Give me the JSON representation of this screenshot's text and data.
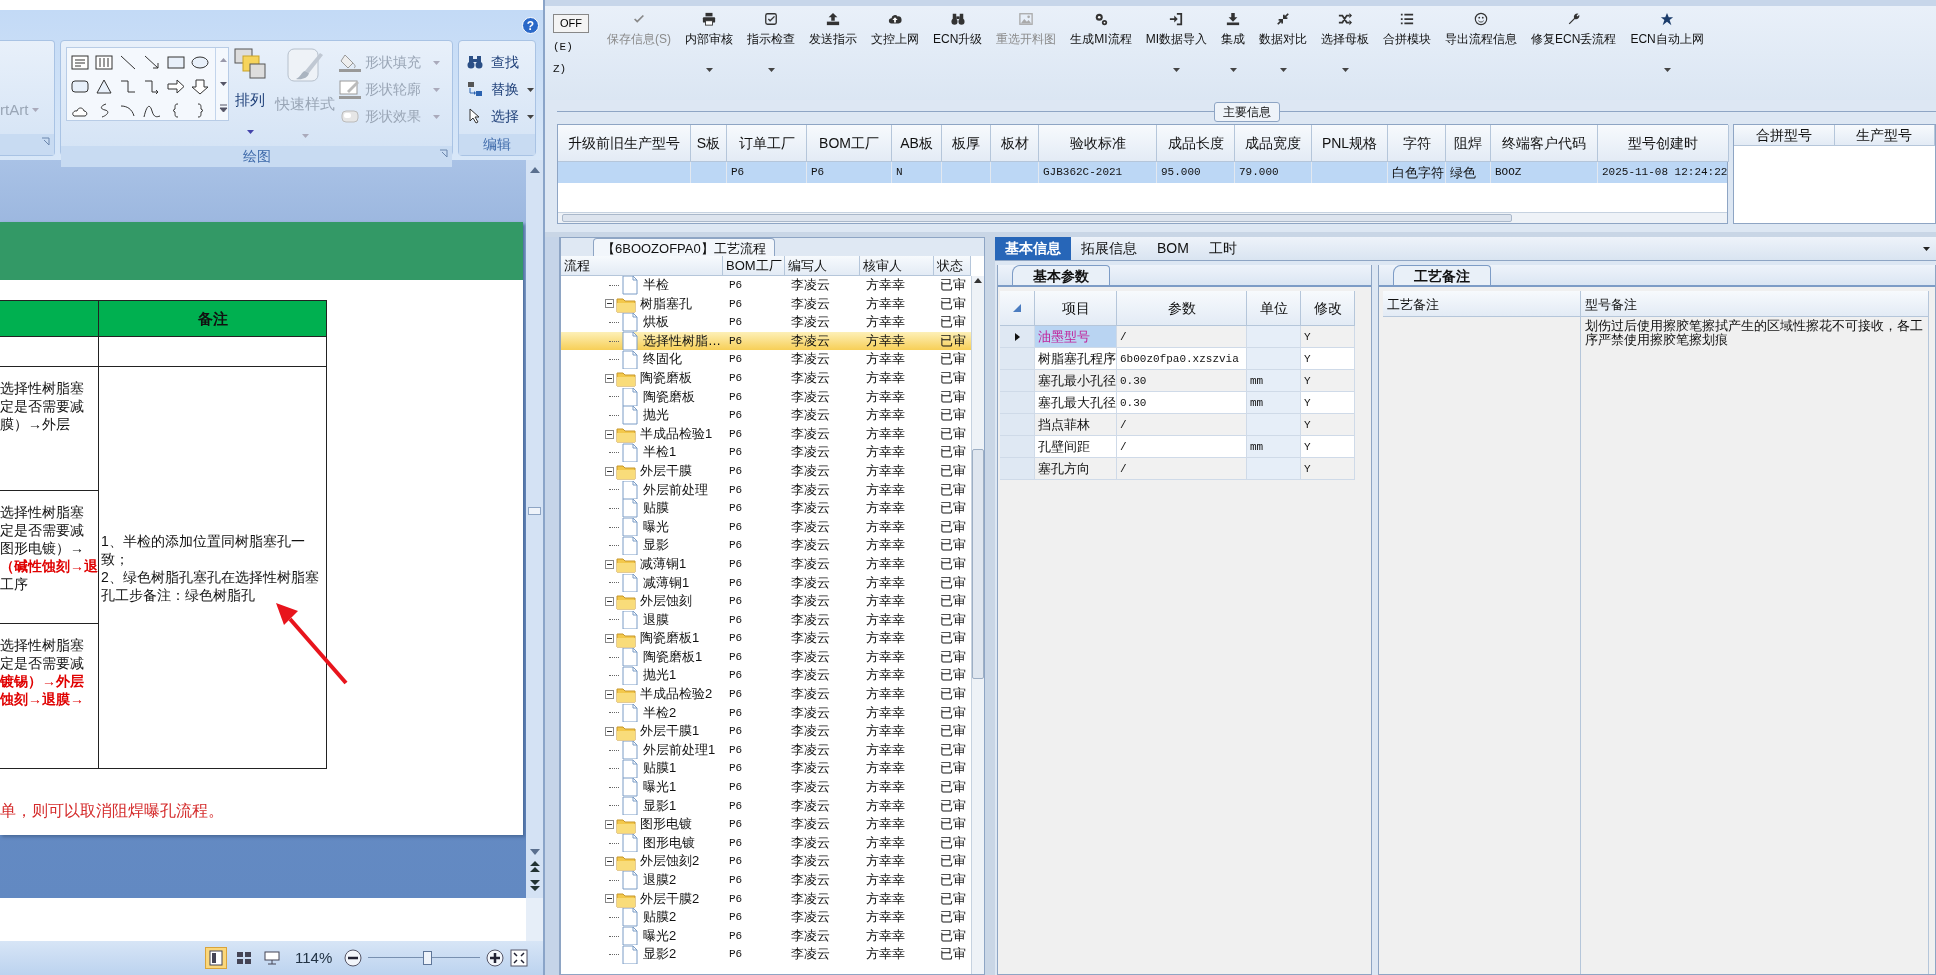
{
  "word": {
    "help_button": "?",
    "ribbon": {
      "smartart": {
        "label": "rtArt",
        "disabled": true
      },
      "drawing": {
        "title": "绘图",
        "arrange": {
          "label": "排列",
          "disabled": false
        },
        "quick_styles": {
          "label": "快速样式",
          "disabled": true
        },
        "shape_fill": {
          "label": "形状填充",
          "disabled": true
        },
        "shape_outline": {
          "label": "形状轮廓",
          "disabled": true
        },
        "shape_effects": {
          "label": "形状效果",
          "disabled": true
        }
      },
      "editing": {
        "title": "编辑",
        "find": "查找",
        "replace": "替换",
        "select": "选择"
      }
    },
    "document": {
      "table": {
        "remarks_header": "备注",
        "rows": [
          {
            "kind": "blank"
          },
          {
            "kind": "text",
            "lines": [
              {
                "text": "选择性树脂塞",
                "emphasis": false
              },
              {
                "text": "定是否需要减",
                "emphasis": false
              },
              {
                "text": "膜）→外层",
                "emphasis": false
              }
            ]
          },
          {
            "kind": "text",
            "lines": [
              {
                "text": "选择性树脂塞",
                "emphasis": false
              },
              {
                "text": "定是否需要减",
                "emphasis": false
              },
              {
                "text": "图形电镀）→",
                "emphasis": false
              },
              {
                "text": "（碱性蚀刻→退",
                "emphasis": true
              },
              {
                "text": "工序",
                "emphasis": false
              }
            ]
          },
          {
            "kind": "text",
            "lines": [
              {
                "text": "选择性树脂塞",
                "emphasis": false
              },
              {
                "text": "定是否需要减",
                "emphasis": false
              },
              {
                "text": "镀锡）→外层",
                "emphasis": true
              },
              {
                "text": "蚀刻→退膜→",
                "emphasis": true
              }
            ]
          }
        ],
        "remarks": [
          "1、半检的添加位置同树脂塞孔一致；",
          "2、绿色树脂孔塞孔在选择性树脂塞孔工步备注：绿色树脂孔"
        ]
      },
      "footer_note": "单，则可以取消阻焊曝孔流程。"
    },
    "status_bar": {
      "view_buttons": [
        {
          "selected": true
        },
        {
          "selected": false
        },
        {
          "selected": false
        }
      ],
      "zoom": "114%",
      "zoom_slider": {
        "level": 0.52
      }
    }
  },
  "app": {
    "toolbar": {
      "off_button": "OFF",
      "menu_fragments": [
        "(E)",
        "Z)"
      ],
      "buttons": [
        {
          "label": "保存信息(S)",
          "disabled": true,
          "dropdown": false
        },
        {
          "label": "内部审核",
          "disabled": false,
          "dropdown": true
        },
        {
          "label": "指示检查",
          "disabled": false,
          "dropdown": true
        },
        {
          "label": "发送指示",
          "disabled": false,
          "dropdown": false
        },
        {
          "label": "文控上网",
          "disabled": false,
          "dropdown": false
        },
        {
          "label": "ECN升级",
          "disabled": false,
          "dropdown": false
        },
        {
          "label": "重选开料图",
          "disabled": true,
          "dropdown": false
        },
        {
          "label": "生成MI流程",
          "disabled": false,
          "dropdown": false
        },
        {
          "label": "MI数据导入",
          "disabled": false,
          "dropdown": true
        },
        {
          "label": "集成",
          "disabled": false,
          "dropdown": true
        },
        {
          "label": "数据对比",
          "disabled": false,
          "dropdown": true
        },
        {
          "label": "选择母板",
          "disabled": false,
          "dropdown": true
        },
        {
          "label": "合拼模块",
          "disabled": false,
          "dropdown": false
        },
        {
          "label": "导出流程信息",
          "disabled": false,
          "dropdown": false
        },
        {
          "label": "修复ECN丢流程",
          "disabled": false,
          "dropdown": false
        },
        {
          "label": "ECN自动上网",
          "disabled": false,
          "dropdown": true
        }
      ]
    },
    "main_info": {
      "title": "主要信息",
      "columns": [
        "升级前旧生产型号",
        "S板",
        "订单工厂",
        "BOM工厂",
        "AB板",
        "板厚",
        "板材",
        "验收标准",
        "成品长度",
        "成品宽度",
        "PNL规格",
        "字符",
        "阻焊",
        "终端客户代码",
        "型号创建时"
      ],
      "rows": [
        {
          "selected": true,
          "cells": [
            null,
            null,
            "P6",
            "P6",
            "N",
            null,
            null,
            "GJB362C-2021",
            "95.000",
            "79.000",
            null,
            "白色字符",
            "绿色",
            "BOOZ",
            "2025-11-08 12:24:22"
          ]
        }
      ],
      "side_columns": [
        "合拼型号",
        "生产型号"
      ]
    },
    "flow_panel": {
      "tab": "【6BOOZOFPA0】工艺流程",
      "columns": [
        "流程",
        "BOM工厂",
        "编写人",
        "核审人",
        "状态"
      ],
      "tree": [
        {
          "kind": "step",
          "label": "半检",
          "bom": "P6",
          "author": "李凌云",
          "reviewer": "方幸幸",
          "status": "已审",
          "selected": false
        },
        {
          "kind": "folder",
          "label": "树脂塞孔",
          "bom": "P6",
          "author": "李凌云",
          "reviewer": "方幸幸",
          "status": "已审",
          "selected": false,
          "expanded": true,
          "children": [
            {
              "kind": "step",
              "label": "烘板",
              "bom": "P6",
              "author": "李凌云",
              "reviewer": "方幸幸",
              "status": "已审",
              "selected": false
            },
            {
              "kind": "step",
              "label": "选择性树脂…",
              "bom": "P6",
              "author": "李凌云",
              "reviewer": "方幸幸",
              "status": "已审",
              "selected": true
            },
            {
              "kind": "step",
              "label": "终固化",
              "bom": "P6",
              "author": "李凌云",
              "reviewer": "方幸幸",
              "status": "已审",
              "selected": false
            }
          ]
        },
        {
          "kind": "folder",
          "label": "陶瓷磨板",
          "bom": "P6",
          "author": "李凌云",
          "reviewer": "方幸幸",
          "status": "已审",
          "selected": false,
          "expanded": true,
          "children": [
            {
              "kind": "step",
              "label": "陶瓷磨板",
              "bom": "P6",
              "author": "李凌云",
              "reviewer": "方幸幸",
              "status": "已审",
              "selected": false
            },
            {
              "kind": "step",
              "label": "抛光",
              "bom": "P6",
              "author": "李凌云",
              "reviewer": "方幸幸",
              "status": "已审",
              "selected": false
            }
          ]
        },
        {
          "kind": "folder",
          "label": "半成品检验1",
          "bom": "P6",
          "author": "李凌云",
          "reviewer": "方幸幸",
          "status": "已审",
          "selected": false,
          "expanded": true,
          "children": [
            {
              "kind": "step",
              "label": "半检1",
              "bom": "P6",
              "author": "李凌云",
              "reviewer": "方幸幸",
              "status": "已审",
              "selected": false
            }
          ]
        },
        {
          "kind": "folder",
          "label": "外层干膜",
          "bom": "P6",
          "author": "李凌云",
          "reviewer": "方幸幸",
          "status": "已审",
          "selected": false,
          "expanded": true,
          "children": [
            {
              "kind": "step",
              "label": "外层前处理",
              "bom": "P6",
              "author": "李凌云",
              "reviewer": "方幸幸",
              "status": "已审",
              "selected": false
            },
            {
              "kind": "step",
              "label": "贴膜",
              "bom": "P6",
              "author": "李凌云",
              "reviewer": "方幸幸",
              "status": "已审",
              "selected": false
            },
            {
              "kind": "step",
              "label": "曝光",
              "bom": "P6",
              "author": "李凌云",
              "reviewer": "方幸幸",
              "status": "已审",
              "selected": false
            },
            {
              "kind": "step",
              "label": "显影",
              "bom": "P6",
              "author": "李凌云",
              "reviewer": "方幸幸",
              "status": "已审",
              "selected": false
            }
          ]
        },
        {
          "kind": "folder",
          "label": "减薄铜1",
          "bom": "P6",
          "author": "李凌云",
          "reviewer": "方幸幸",
          "status": "已审",
          "selected": false,
          "expanded": true,
          "children": [
            {
              "kind": "step",
              "label": "减薄铜1",
              "bom": "P6",
              "author": "李凌云",
              "reviewer": "方幸幸",
              "status": "已审",
              "selected": false
            }
          ]
        },
        {
          "kind": "folder",
          "label": "外层蚀刻",
          "bom": "P6",
          "author": "李凌云",
          "reviewer": "方幸幸",
          "status": "已审",
          "selected": false,
          "expanded": true,
          "children": [
            {
              "kind": "step",
              "label": "退膜",
              "bom": "P6",
              "author": "李凌云",
              "reviewer": "方幸幸",
              "status": "已审",
              "selected": false
            }
          ]
        },
        {
          "kind": "folder",
          "label": "陶瓷磨板1",
          "bom": "P6",
          "author": "李凌云",
          "reviewer": "方幸幸",
          "status": "已审",
          "selected": false,
          "expanded": true,
          "children": [
            {
              "kind": "step",
              "label": "陶瓷磨板1",
              "bom": "P6",
              "author": "李凌云",
              "reviewer": "方幸幸",
              "status": "已审",
              "selected": false
            },
            {
              "kind": "step",
              "label": "抛光1",
              "bom": "P6",
              "author": "李凌云",
              "reviewer": "方幸幸",
              "status": "已审",
              "selected": false
            }
          ]
        },
        {
          "kind": "folder",
          "label": "半成品检验2",
          "bom": "P6",
          "author": "李凌云",
          "reviewer": "方幸幸",
          "status": "已审",
          "selected": false,
          "expanded": true,
          "children": [
            {
              "kind": "step",
              "label": "半检2",
              "bom": "P6",
              "author": "李凌云",
              "reviewer": "方幸幸",
              "status": "已审",
              "selected": false
            }
          ]
        },
        {
          "kind": "folder",
          "label": "外层干膜1",
          "bom": "P6",
          "author": "李凌云",
          "reviewer": "方幸幸",
          "status": "已审",
          "selected": false,
          "expanded": true,
          "children": [
            {
              "kind": "step",
              "label": "外层前处理1",
              "bom": "P6",
              "author": "李凌云",
              "reviewer": "方幸幸",
              "status": "已审",
              "selected": false
            },
            {
              "kind": "step",
              "label": "贴膜1",
              "bom": "P6",
              "author": "李凌云",
              "reviewer": "方幸幸",
              "status": "已审",
              "selected": false
            },
            {
              "kind": "step",
              "label": "曝光1",
              "bom": "P6",
              "author": "李凌云",
              "reviewer": "方幸幸",
              "status": "已审",
              "selected": false
            },
            {
              "kind": "step",
              "label": "显影1",
              "bom": "P6",
              "author": "李凌云",
              "reviewer": "方幸幸",
              "status": "已审",
              "selected": false
            }
          ]
        },
        {
          "kind": "folder",
          "label": "图形电镀",
          "bom": "P6",
          "author": "李凌云",
          "reviewer": "方幸幸",
          "status": "已审",
          "selected": false,
          "expanded": true,
          "children": [
            {
              "kind": "step",
              "label": "图形电镀",
              "bom": "P6",
              "author": "李凌云",
              "reviewer": "方幸幸",
              "status": "已审",
              "selected": false
            }
          ]
        },
        {
          "kind": "folder",
          "label": "外层蚀刻2",
          "bom": "P6",
          "author": "李凌云",
          "reviewer": "方幸幸",
          "status": "已审",
          "selected": false,
          "expanded": true,
          "children": [
            {
              "kind": "step",
              "label": "退膜2",
              "bom": "P6",
              "author": "李凌云",
              "reviewer": "方幸幸",
              "status": "已审",
              "selected": false
            }
          ]
        },
        {
          "kind": "folder",
          "label": "外层干膜2",
          "bom": "P6",
          "author": "李凌云",
          "reviewer": "方幸幸",
          "status": "已审",
          "selected": false,
          "expanded": true,
          "children": [
            {
              "kind": "step",
              "label": "贴膜2",
              "bom": "P6",
              "author": "李凌云",
              "reviewer": "方幸幸",
              "status": "已审",
              "selected": false
            },
            {
              "kind": "step",
              "label": "曝光2",
              "bom": "P6",
              "author": "李凌云",
              "reviewer": "方幸幸",
              "status": "已审",
              "selected": false
            },
            {
              "kind": "step",
              "label": "显影2",
              "bom": "P6",
              "author": "李凌云",
              "reviewer": "方幸幸",
              "status": "已审",
              "selected": false
            }
          ]
        }
      ]
    },
    "detail_panel": {
      "tabs": [
        {
          "label": "基本信息",
          "selected": true
        },
        {
          "label": "拓展信息",
          "selected": false
        },
        {
          "label": "BOM",
          "selected": false
        },
        {
          "label": "工时",
          "selected": false
        }
      ],
      "params": {
        "tab": "基本参数",
        "columns": [
          "项目",
          "参数",
          "单位",
          "修改"
        ],
        "rows": [
          {
            "name": "油墨型号",
            "value": "/",
            "modified": "Y",
            "selected": true
          },
          {
            "name": "树脂塞孔程序",
            "value": "6b00z0fpa0.xzszvia",
            "modified": "Y",
            "selected": false
          },
          {
            "name": "塞孔最小孔径",
            "value": "0.30",
            "unit": "mm",
            "modified": "Y",
            "selected": false
          },
          {
            "name": "塞孔最大孔径",
            "value": "0.30",
            "unit": "mm",
            "modified": "Y",
            "selected": false
          },
          {
            "name": "挡点菲林",
            "value": "/",
            "modified": "Y",
            "selected": false
          },
          {
            "name": "孔壁间距",
            "value": "/",
            "unit": "mm",
            "modified": "Y",
            "selected": false
          },
          {
            "name": "塞孔方向",
            "value": "/",
            "modified": "Y",
            "selected": false
          }
        ]
      },
      "notes": {
        "tab": "工艺备注",
        "columns": [
          "工艺备注",
          "型号备注"
        ],
        "model_note": "划伤过后使用擦胶笔擦拭产生的区域性擦花不可接收，各工序严禁使用擦胶笔擦划痕"
      }
    }
  }
}
